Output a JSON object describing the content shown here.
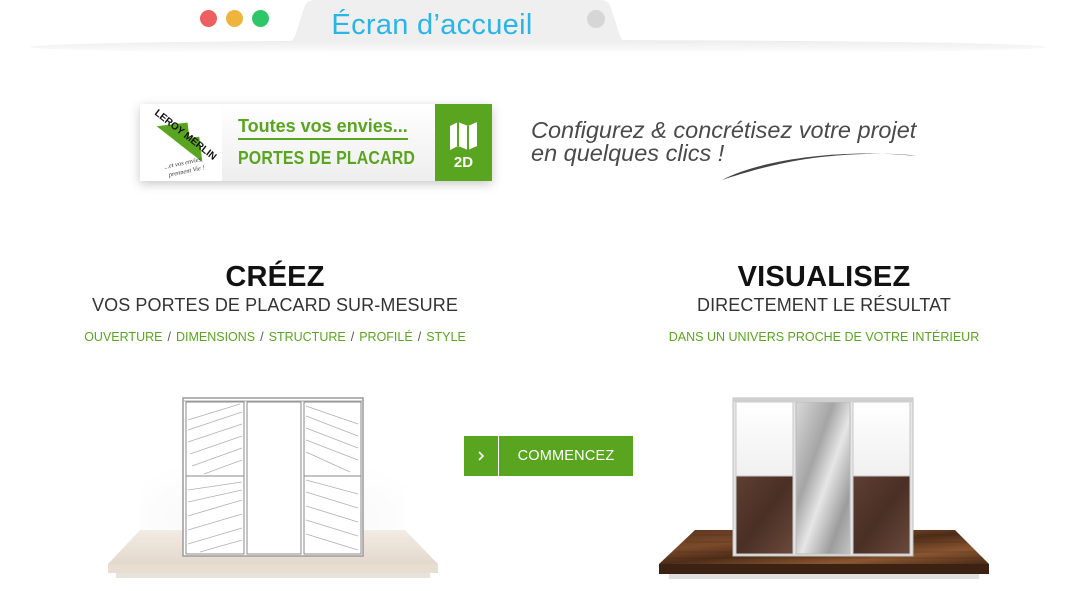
{
  "window": {
    "tab_title": "Écran d’accueil",
    "controls": [
      "close-dot",
      "minimize-dot",
      "maximize-dot"
    ]
  },
  "banner": {
    "logo_brand": "LEROY MERLIN",
    "logo_slogan": "...et vos envies prennent Vie !",
    "line1": "Toutes vos envies...",
    "line2": "PORTES DE PLACARD",
    "badge": "2D",
    "accent_color": "#5aa51f"
  },
  "tagline": {
    "line1": "Configurez & concrétisez votre projet",
    "line2": "en quelques clics !"
  },
  "create": {
    "heading": "CRÉEZ",
    "subheading": "VOS PORTES DE PLACARD SUR-MESURE",
    "features": [
      "OUVERTURE",
      "DIMENSIONS",
      "STRUCTURE",
      "PROFILÉ",
      "STYLE"
    ],
    "separator": "/"
  },
  "visualize": {
    "heading": "VISUALISEZ",
    "subheading": "DIRECTEMENT LE RÉSULTAT",
    "detail": "DANS UN UNIVERS PROCHE DE VOTRE INTÉRIEUR"
  },
  "cta": {
    "label": "COMMENCEZ",
    "icon": "chevron-right-icon"
  },
  "colors": {
    "tab_title": "#2ab5e8",
    "green": "#5aa51f",
    "dot_red": "#ee5f61",
    "dot_yellow": "#eeb43e",
    "dot_green": "#2fc66a"
  }
}
